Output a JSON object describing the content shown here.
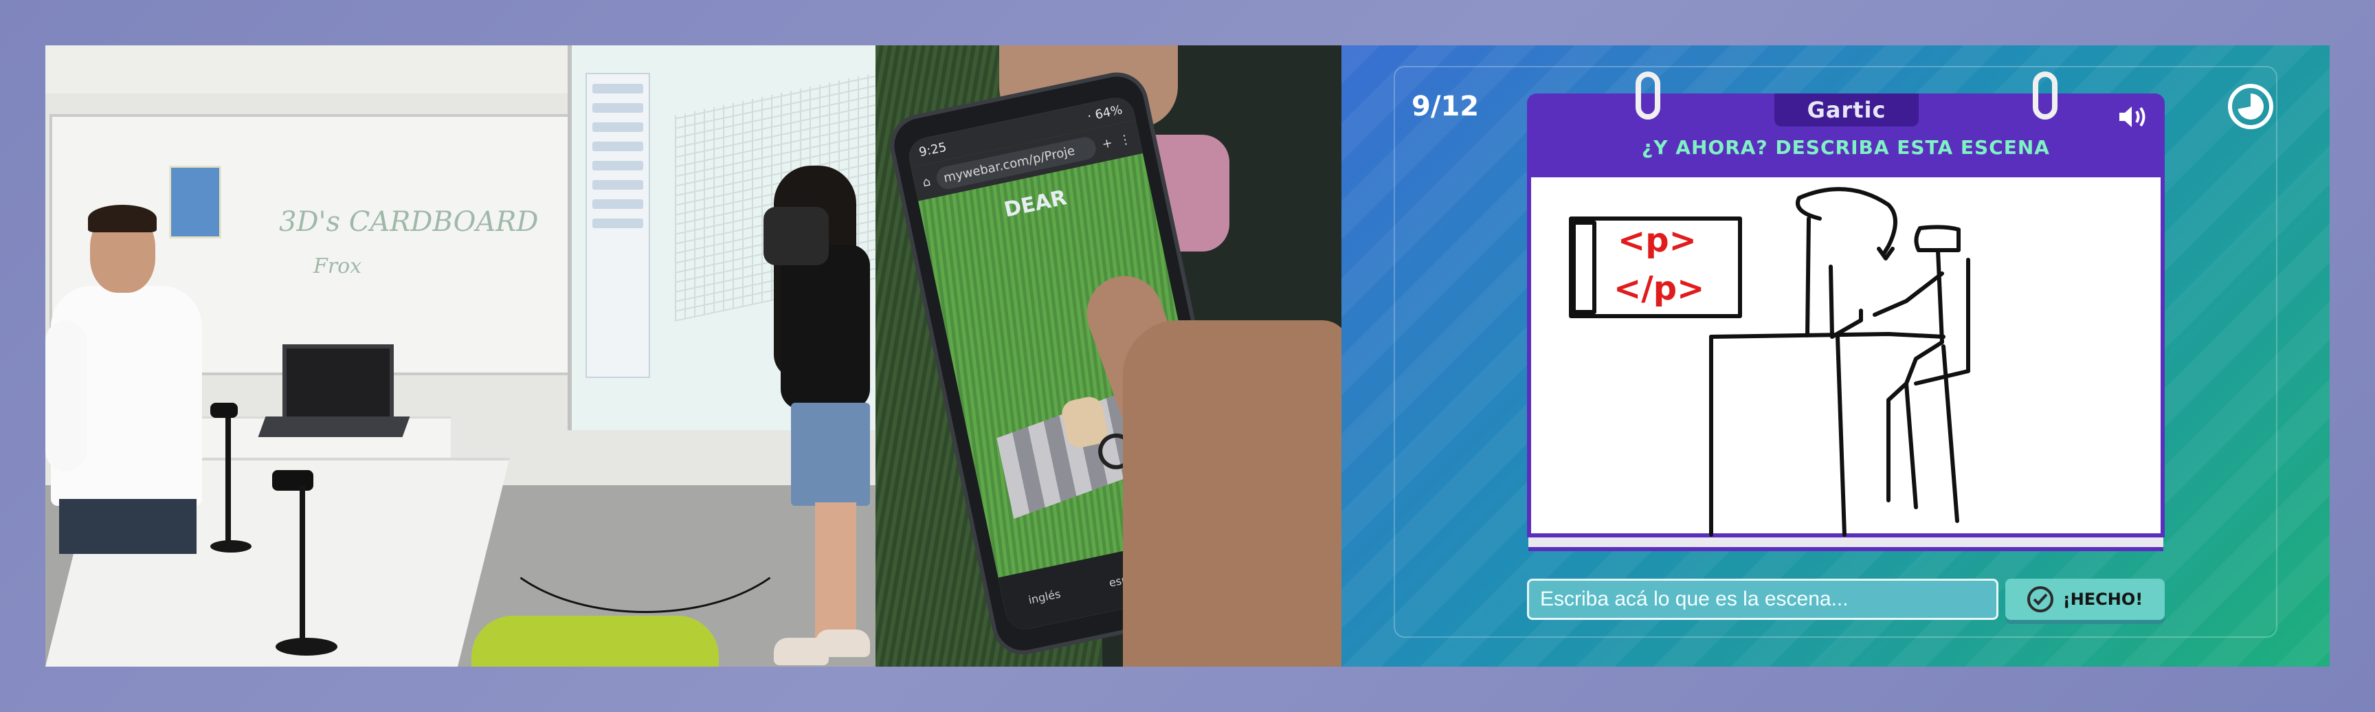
{
  "photo1": {
    "whiteboard_text_1": "3D's  CARDBOARD",
    "whiteboard_text_2": "Frox"
  },
  "photo2": {
    "status_time": "9:25",
    "status_right": "⋅ 64%",
    "url_text": "mywebar.com/p/Proje",
    "brand_text": "DEAR",
    "lang_1": "inglés",
    "lang_2": "español"
  },
  "gartic": {
    "round_counter": "9/12",
    "logo_text": "Gartic",
    "prompt": "¿Y AHORA? DESCRIBA ESTA ESCENA",
    "drawing_text_1": "<p>",
    "drawing_text_2": "</p>",
    "input_placeholder": "Escriba acá lo que es la escena...",
    "done_label": "¡HECHO!",
    "colors": {
      "accent_purple": "#5b2fbd",
      "prompt_green": "#7ff2c4",
      "button_teal": "#6ad0c8"
    }
  },
  "icons": [
    "sound-icon",
    "timer-icon",
    "check-icon"
  ]
}
